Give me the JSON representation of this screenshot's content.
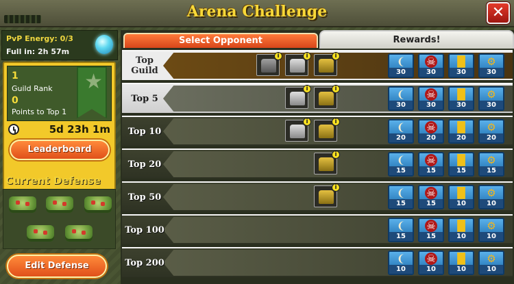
{
  "header": {
    "title": "Arena Challenge",
    "close_glyph": "✕"
  },
  "energy": {
    "label": "PvP Energy: 0/3",
    "full_in": "Full in: 2h 57m"
  },
  "rank": {
    "guild_rank": "1",
    "guild_rank_label": "Guild Rank",
    "points": "0",
    "points_label": "Points to Top 1",
    "time_left": "5d 23h 1m"
  },
  "buttons": {
    "leaderboard": "Leaderboard",
    "edit_defense": "Edit Defense"
  },
  "defense": {
    "title": "Current Defense"
  },
  "tabs": {
    "select": "Select Opponent",
    "rewards": "Rewards!"
  },
  "colors": {
    "accent_gold": "#f8d838",
    "tab_orange": "#e8602a",
    "reward_blue": "#2a84cc"
  },
  "rows": [
    {
      "rank": "Top Guild",
      "style": "gold",
      "opponents": [
        "tank1",
        "tank2",
        "tank3"
      ],
      "rewards": [
        "30",
        "30",
        "30",
        "30"
      ]
    },
    {
      "rank": "Top 5",
      "style": "sel",
      "opponents": [
        "tank2",
        "tank3"
      ],
      "rewards": [
        "30",
        "30",
        "30",
        "30"
      ]
    },
    {
      "rank": "Top 10",
      "style": "dark",
      "opponents": [
        "tank2",
        "tank3"
      ],
      "rewards": [
        "20",
        "20",
        "20",
        "20"
      ]
    },
    {
      "rank": "Top 20",
      "style": "dark",
      "opponents": [
        "tank3"
      ],
      "rewards": [
        "15",
        "15",
        "15",
        "15"
      ]
    },
    {
      "rank": "Top 50",
      "style": "dark",
      "opponents": [
        "tank3"
      ],
      "rewards": [
        "15",
        "15",
        "10",
        "10"
      ]
    },
    {
      "rank": "Top 100",
      "style": "dark",
      "opponents": [],
      "rewards": [
        "15",
        "15",
        "10",
        "10"
      ]
    },
    {
      "rank": "Top 200",
      "style": "dark",
      "opponents": [],
      "rewards": [
        "10",
        "10",
        "10",
        "10"
      ]
    }
  ],
  "reward_icons": [
    "tusk-icon",
    "skull-icon",
    "medal-icon",
    "gear-icon"
  ]
}
